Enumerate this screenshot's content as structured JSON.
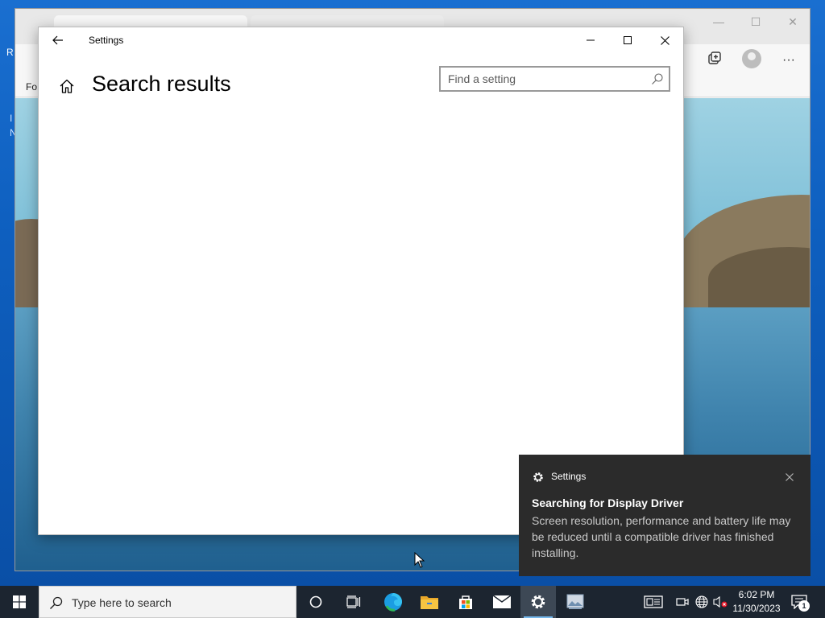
{
  "desktop": {
    "letters": [
      "R",
      "I",
      "N"
    ]
  },
  "background_window": {
    "favorites_text": "Fo"
  },
  "settings_window": {
    "title": "Settings",
    "page_title": "Search results",
    "search": {
      "value": "",
      "placeholder": "Find a setting"
    }
  },
  "toast": {
    "app_name": "Settings",
    "title": "Searching for Display Driver",
    "body": "Screen resolution, performance and battery life may be reduced until a compatible driver has finished installing."
  },
  "taskbar": {
    "search_placeholder": "Type here to search",
    "pinned": [
      "cortana-icon",
      "task-view-icon",
      "edge-icon",
      "file-explorer-icon",
      "store-icon",
      "mail-icon",
      "settings-icon",
      "image-viewer-icon"
    ],
    "active_app": "settings-icon",
    "clock": {
      "time": "6:02 PM",
      "date": "11/30/2023"
    },
    "notification_count": "1"
  },
  "colors": {
    "taskbar_bg": "#1c2530",
    "toast_bg": "#2b2b2b",
    "accent": "#76b9ed"
  }
}
